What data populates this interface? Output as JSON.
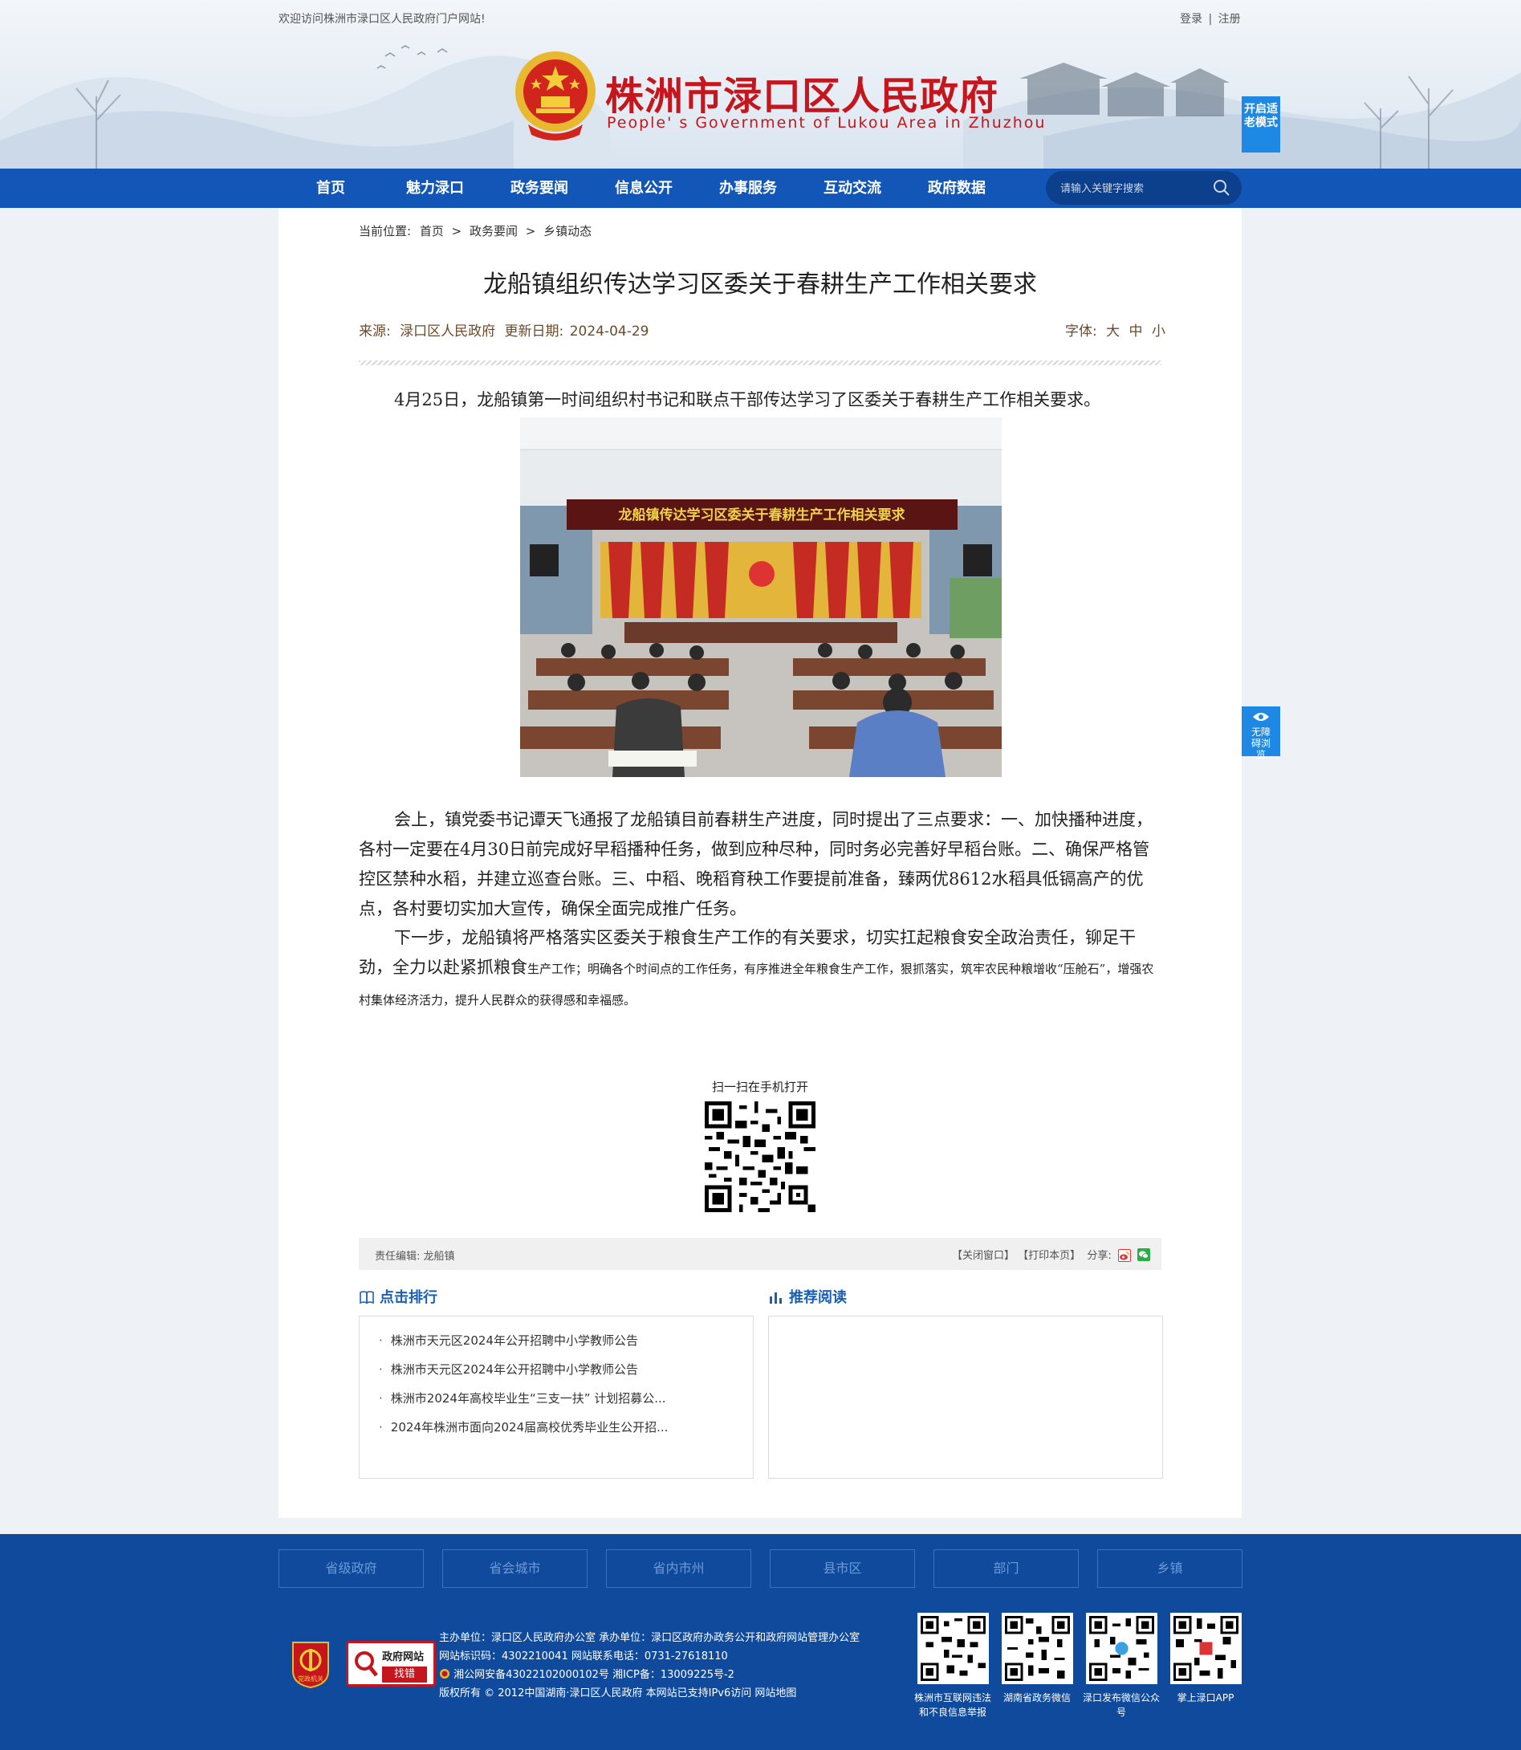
{
  "header": {
    "welcome": "欢迎访问株洲市渌口区人民政府门户网站!",
    "login": "登录",
    "separator": "|",
    "register": "注册",
    "site_title": "株洲市渌口区人民政府",
    "site_subtitle": "People' s Government of Lukou Area in Zhuzhou",
    "elder_mode": "开启适老模式"
  },
  "nav": {
    "items": [
      "首页",
      "魅力渌口",
      "政务要闻",
      "信息公开",
      "办事服务",
      "互动交流",
      "政府数据"
    ],
    "search_placeholder": "请输入关键字搜索"
  },
  "breadcrumb": {
    "label": "当前位置:",
    "items": [
      "首页",
      "政务要闻",
      "乡镇动态"
    ],
    "sep": ">"
  },
  "article": {
    "title": "龙船镇组织传达学习区委关于春耕生产工作相关要求",
    "source_label": "来源:",
    "source": "渌口区人民政府",
    "date_label": "更新日期:",
    "date": "2024-04-29",
    "font_label": "字体:",
    "font_sizes": [
      "大",
      "中",
      "小"
    ],
    "para1": "4月25日，龙船镇第一时间组织村书记和联点干部传达学习了区委关于春耕生产工作相关要求。",
    "banner_text": "龙船镇传达学习区委关于春耕生产工作相关要求",
    "para2": "会上，镇党委书记谭天飞通报了龙船镇目前春耕生产进度，同时提出了三点要求：一、加快播种进度，各村一定要在4月30日前完成好早稻播种任务，做到应种尽种，同时务必完善好早稻台账。二、确保严格管控区禁种水稻，并建立巡查台账。三、中稻、晚稻育秧工作要提前准备，臻两优8612水稻具低镉高产的优点，各村要切实加大宣传，确保全面完成推广任务。",
    "para3_main": "下一步，龙船镇将严格落实区委关于粮食生产工作的有关要求，切实扛起粮食安全政治责任，铆足干劲，全力以赴紧抓粮食",
    "para3_small": "生产工作；明确各个时间点的工作任务，有序推进全年粮食生产工作，狠抓落实，筑牢农民种粮增收“压舱石”，增强农村集体经济活力，提升人民群众的获得感和幸福感。",
    "qr_label": "扫一扫在手机打开"
  },
  "editor_bar": {
    "editor_label": "责任编辑:",
    "editor": "龙船镇",
    "close": "【关闭窗口】",
    "print": "【打印本页】",
    "share": "分享:"
  },
  "rank": {
    "title": "点击排行",
    "items": [
      "株洲市天元区2024年公开招聘中小学教师公告",
      "株洲市天元区2024年公开招聘中小学教师公告",
      "株洲市2024年高校毕业生“三支一扶” 计划招募公...",
      "2024年株洲市面向2024届高校优秀毕业生公开招..."
    ]
  },
  "recommend": {
    "title": "推荐阅读"
  },
  "footer": {
    "links": [
      "省级政府",
      "省会城市",
      "省内市州",
      "县市区",
      "部门",
      "乡镇"
    ],
    "badge_top": "政府网站",
    "badge_bottom": "找错",
    "badge_party": "党政机关",
    "line1": "主办单位：渌口区人民政府办公室 承办单位：渌口区政府办政务公开和政府网站管理办公室",
    "line2": "网站标识码：4302210041 网站联系电话：0731-27618110",
    "line3": "湘公网安备43022102000102号 湘ICP备：13009225号-2",
    "line4": "版权所有 © 2012中国湖南·渌口区人民政府 本网站已支持IPv6访问 网站地图",
    "qr_captions": [
      "株洲市互联网违法和不良信息举报",
      "湖南省政务微信",
      "渌口发布微信公众号",
      "掌上渌口APP"
    ]
  },
  "accessibility": {
    "label": "无障碍浏览"
  },
  "colors": {
    "nav": "#1257b8",
    "title_red": "#c4161c",
    "footer": "#0f4a9c",
    "accent_blue": "#1e88e5"
  }
}
